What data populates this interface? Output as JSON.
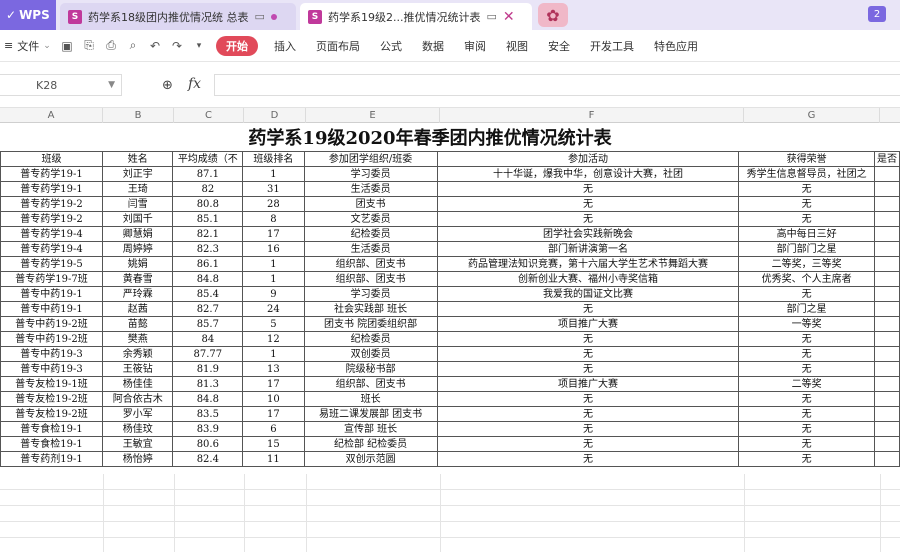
{
  "app": {
    "logo": "WPS",
    "tabs": [
      {
        "title": "药学系18级团内推优情况统 总表"
      },
      {
        "title": "药学系19级2...推优情况统计表"
      }
    ],
    "badge": "2"
  },
  "menu": {
    "file": "文件",
    "items": [
      "开始",
      "插入",
      "页面布局",
      "公式",
      "数据",
      "审阅",
      "视图",
      "安全",
      "开发工具",
      "特色应用"
    ]
  },
  "formula": {
    "cell_ref": "K28",
    "fx": "fx",
    "value": ""
  },
  "columns": [
    "A",
    "B",
    "C",
    "D",
    "E",
    "F",
    "G"
  ],
  "sheet": {
    "title": "药学系19级2020年春季团内推优情况统计表",
    "headers": [
      "班级",
      "姓名",
      "平均成绩（不",
      "班级排名",
      "参加团学组织/班委",
      "参加活动",
      "获得荣誉",
      "是否"
    ],
    "rows": [
      [
        "普专药学19-1",
        "刘正宇",
        "87.1",
        "1",
        "学习委员",
        "十十华诞，爆我中华，创意设计大赛，社团",
        "秀学生信息督导员，社团之",
        ""
      ],
      [
        "普专药学19-1",
        "王琦",
        "82",
        "31",
        "生活委员",
        "无",
        "无",
        ""
      ],
      [
        "普专药学19-2",
        "闫雪",
        "80.8",
        "28",
        "团支书",
        "无",
        "无",
        ""
      ],
      [
        "普专药学19-2",
        "刘国千",
        "85.1",
        "8",
        "文艺委员",
        "无",
        "无",
        ""
      ],
      [
        "普专药学19-4",
        "卿慧娟",
        "82.1",
        "17",
        "纪检委员",
        "团学社会实践新晚会",
        "高中每日三好",
        ""
      ],
      [
        "普专药学19-4",
        "周婷婷",
        "82.3",
        "16",
        "生活委员",
        "部门新讲演第一名",
        "部门部门之星",
        ""
      ],
      [
        "普专药学19-5",
        "姚娟",
        "86.1",
        "1",
        "组织部、团支书",
        "药品管理法知识竞赛，第十六届大学生艺术节舞蹈大赛",
        "二等奖，三等奖",
        ""
      ],
      [
        "普专药学19-7班",
        "黄春雪",
        "84.8",
        "1",
        "组织部、团支书",
        "创新创业大赛、福州小寺奖信箱",
        "优秀奖、个人主席者",
        ""
      ],
      [
        "普专中药19-1",
        "严玲霖",
        "85.4",
        "9",
        "学习委员",
        "我爱我的国证文比赛",
        "无",
        ""
      ],
      [
        "普专中药19-1",
        "赵茜",
        "82.7",
        "24",
        "社会实践部 班长",
        "无",
        "部门之星",
        ""
      ],
      [
        "普专中药19-2班",
        "苗懿",
        "85.7",
        "5",
        "团支书 院团委组织部",
        "项目推广大赛",
        "一等奖",
        ""
      ],
      [
        "普专中药19-2班",
        "樊燕",
        "84",
        "12",
        "纪检委员",
        "无",
        "无",
        ""
      ],
      [
        "普专中药19-3",
        "余秀颖",
        "87.77",
        "1",
        "双创委员",
        "无",
        "无",
        ""
      ],
      [
        "普专中药19-3",
        "王筱钻",
        "81.9",
        "13",
        "院级秘书部",
        "无",
        "无",
        ""
      ],
      [
        "普专友检19-1班",
        "杨佳佳",
        "81.3",
        "17",
        "组织部、团支书",
        "项目推广大赛",
        "二等奖",
        ""
      ],
      [
        "普专友检19-2班",
        "阿合依古木",
        "84.8",
        "10",
        "班长",
        "无",
        "无",
        ""
      ],
      [
        "普专友检19-2班",
        "罗小军",
        "83.5",
        "17",
        "易班二课发展部 团支书",
        "无",
        "无",
        ""
      ],
      [
        "普专食检19-1",
        "杨佳玟",
        "83.9",
        "6",
        "宣传部 班长",
        "无",
        "无",
        ""
      ],
      [
        "普专食检19-1",
        "王敏宜",
        "80.6",
        "15",
        "纪检部 纪检委员",
        "无",
        "无",
        ""
      ],
      [
        "普专药剂19-1",
        "杨怡婷",
        "82.4",
        "11",
        "双创示范圆",
        "无",
        "无",
        ""
      ]
    ]
  }
}
